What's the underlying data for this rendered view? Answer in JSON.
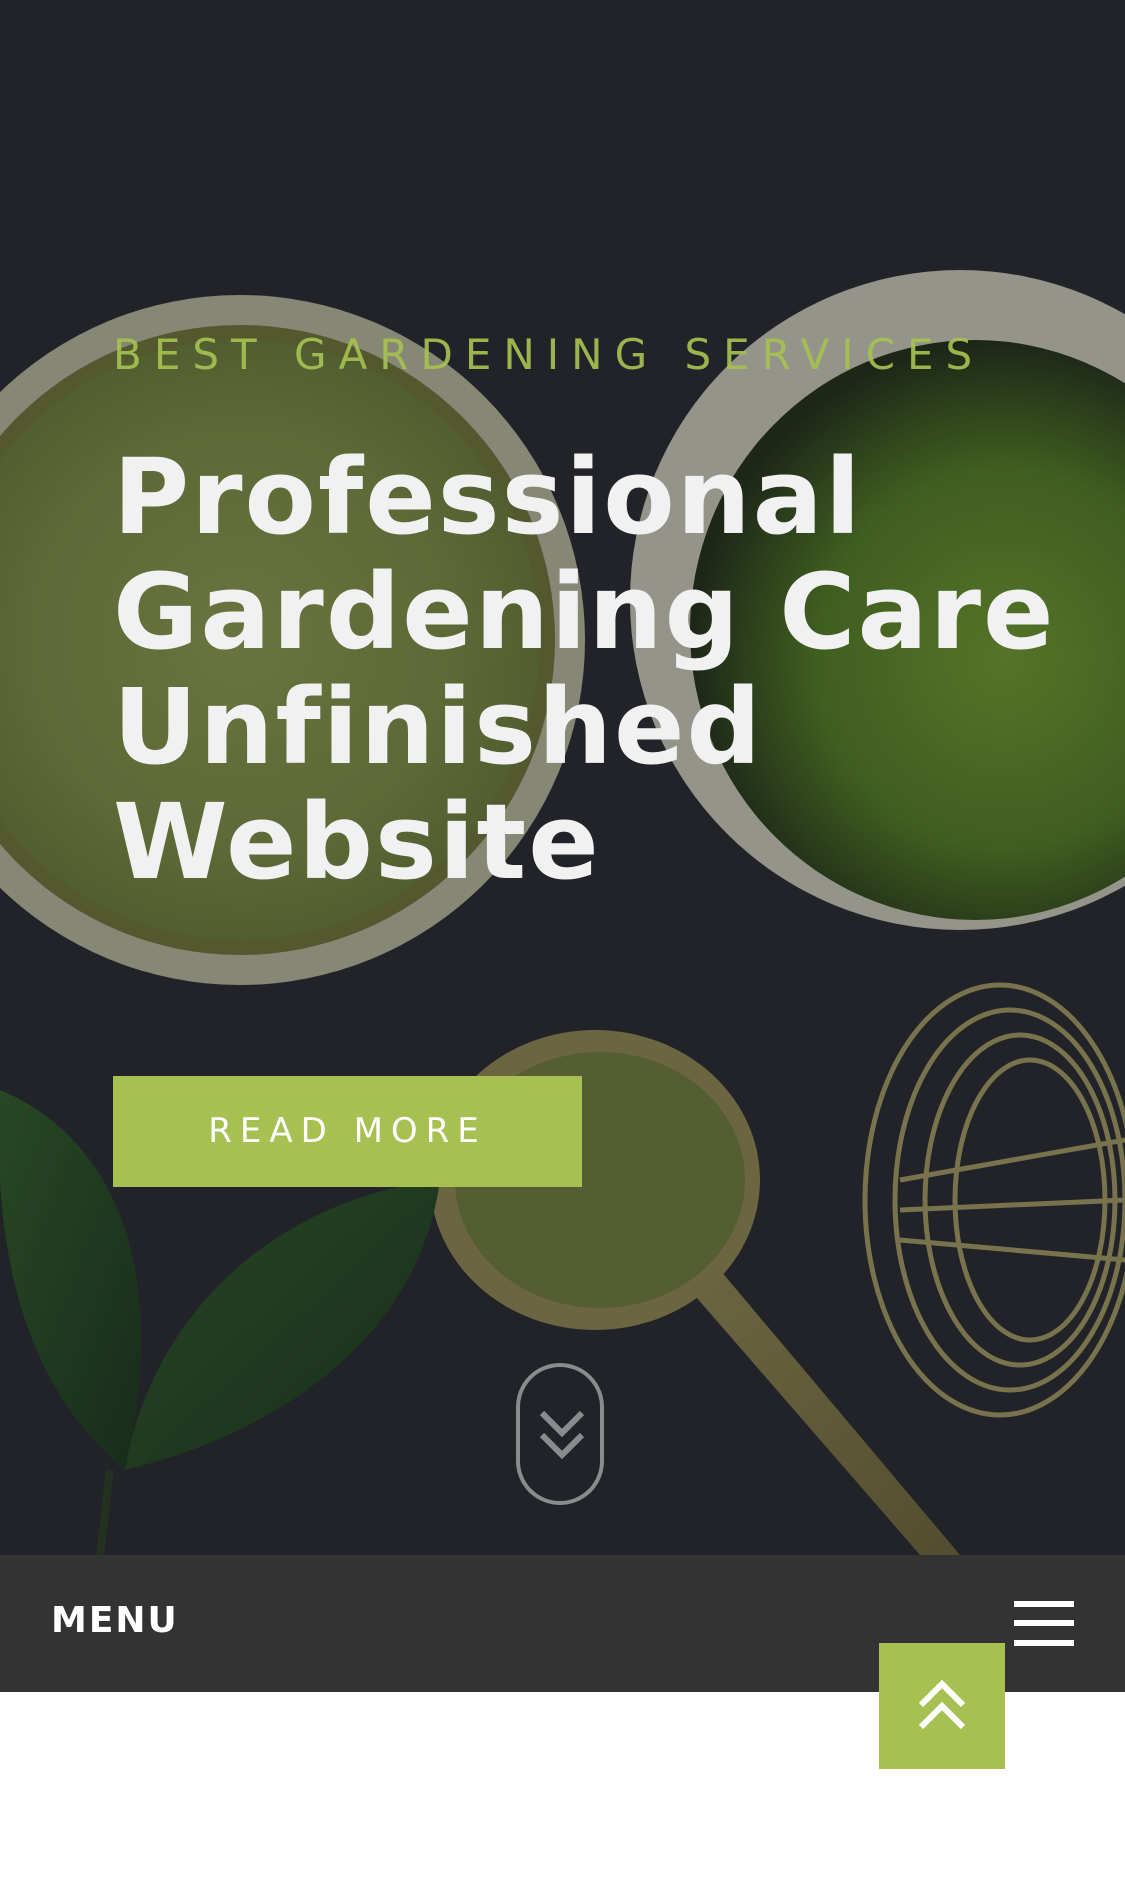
{
  "hero": {
    "eyebrow": "BEST GARDENING SERVICES",
    "headline_lines": [
      "Professional",
      "Gardening Care",
      "Unfinished",
      "Website"
    ],
    "cta_label": "READ MORE",
    "scroll_icon": "double-chevron-down-icon"
  },
  "menubar": {
    "label": "MENU",
    "toggle_icon": "hamburger-icon"
  },
  "back_to_top": {
    "icon": "double-chevron-up-icon"
  },
  "colors": {
    "accent": "#a6c151",
    "hero_bg": "#25262b",
    "menubar_bg": "#333333",
    "headline": "#f1f1f1"
  }
}
